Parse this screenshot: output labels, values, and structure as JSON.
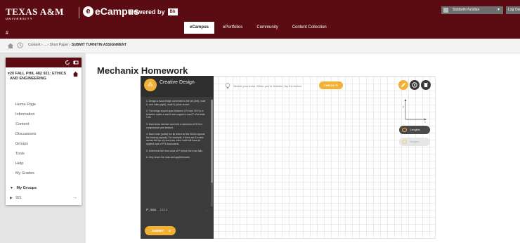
{
  "header": {
    "institution_name": "TEXAS A&M",
    "institution_sub": "UNIVERSITY",
    "brand_name": "eCampus",
    "powered_by": "Powered by",
    "powered_logo": "Bb",
    "user_name": "Siddarth Pandian",
    "logout_label": "Log Out",
    "hash_mark": "#",
    "tabs": [
      {
        "label": "eCampus",
        "active": true
      },
      {
        "label": "ePortfolios",
        "active": false
      },
      {
        "label": "Community",
        "active": false
      },
      {
        "label": "Content Collection",
        "active": false
      }
    ]
  },
  "breadcrumb": {
    "part1": "Content",
    "part2": "...",
    "part3": "Short Paper",
    "current": "SUBMIT TURNITIN ASSIGNMENT",
    "separator": "›"
  },
  "course": {
    "title": "20 FALL PHIL 482 921: ETHICS AND ENGINEERING",
    "menu": [
      "Home Page",
      "Information",
      "Content",
      "Discussions",
      "Groups",
      "Tools",
      "Help",
      "My Grades"
    ],
    "my_groups_label": "My Groups",
    "group_item": "921",
    "group_link_glyph": "→",
    "expand_glyph": "▼",
    "collapse_glyph": "▶"
  },
  "main": {
    "title": "Mechanix Homework"
  },
  "design_panel": {
    "logo_glyph": "⁂",
    "title": "Creative Design",
    "instructions": [
      "1. Design a truss bridge connected to the pin (left), node A, and roller (right), node B, joints shown.",
      "2. The bridge should span between 10 ft and 15 ft is in between nodes A and B and support a load P of at least 1.0k.",
      "3. Each truss member can hold a maximum of 8.0k in compression and tension.",
      "4. Each node (joints) the tip where all the forces oppose the loading capacity. For example, if there are 3 nodes across the top of your truss, each node will have an applied load of P/3 downwards.",
      "5. Determine the max value of P before the truss fails.",
      "6. Only share the truss and applied loads."
    ],
    "select_label": "P_max",
    "select_value": "123.4",
    "select_grip": "…",
    "submit_label": "SUBMIT",
    "submit_arrow": "▸"
  },
  "canvas": {
    "hint_text": "Sketch your truss. When you're finished, tap the button",
    "hint_button": "CHECK IT!",
    "axis_y": "y",
    "axis_x": "x",
    "pill_lengths": "Lengths",
    "pill_angles": "Angles"
  },
  "colors": {
    "maroon": "#5a0c12",
    "accent_gold": "#f2b035",
    "panel_dark": "#3b3b3b"
  },
  "icons": {
    "home": "home-icon",
    "recent": "clock-icon",
    "pencil": "pencil-icon",
    "target": "target-icon",
    "trash": "trash-icon",
    "bulb": "lightbulb-icon"
  }
}
